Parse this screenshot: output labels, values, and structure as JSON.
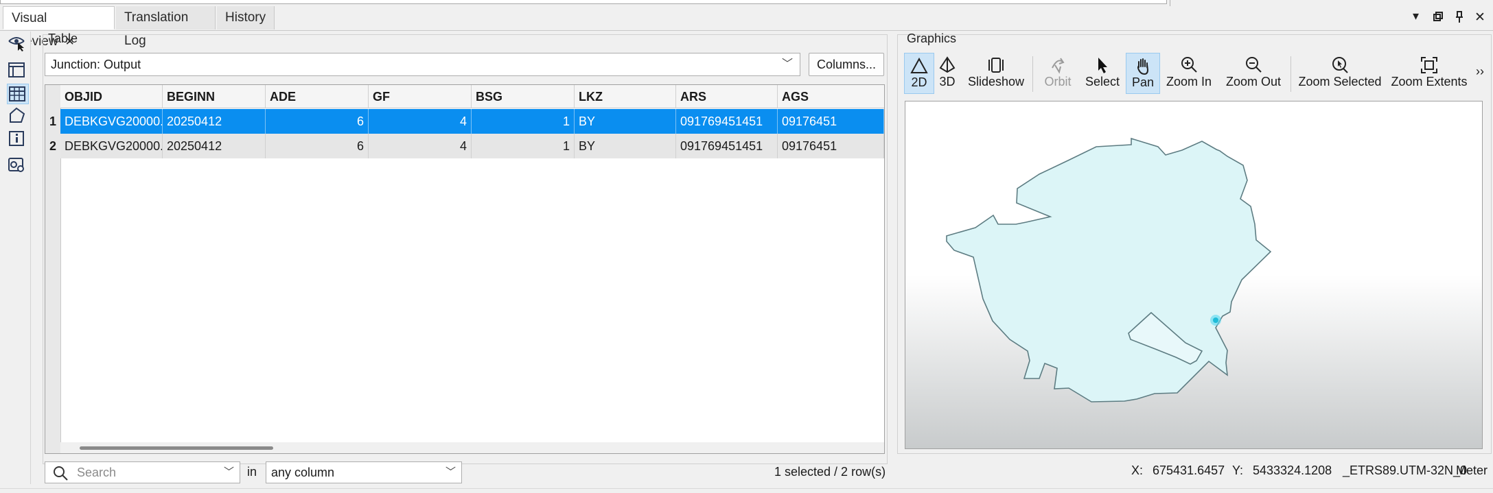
{
  "tabs": [
    {
      "label": "Visual Preview",
      "active": true
    },
    {
      "label": "Translation Log",
      "active": false
    },
    {
      "label": "History",
      "active": false
    }
  ],
  "left_toolbar": {
    "items": [
      "eye-select-icon",
      "layout-icon",
      "table-icon",
      "polygon-icon",
      "info-icon",
      "settings-card-icon"
    ],
    "selected": "table-icon"
  },
  "table": {
    "panel_title": "Table",
    "source_select": "Junction: Output",
    "columns_button": "Columns...",
    "headers": [
      "OBJID",
      "BEGINN",
      "ADE",
      "GF",
      "BSG",
      "LKZ",
      "ARS",
      "AGS"
    ],
    "rows": [
      {
        "num": "1",
        "cells": [
          "DEBKGVG20000...",
          "20250412",
          "6",
          "4",
          "1",
          "BY",
          "091769451451",
          "09176451"
        ],
        "selected": true
      },
      {
        "num": "2",
        "cells": [
          "DEBKGVG20000...",
          "20250412",
          "6",
          "4",
          "1",
          "BY",
          "091769451451",
          "09176451"
        ],
        "selected": false
      }
    ],
    "search_placeholder": "Search",
    "in_label": "in",
    "column_filter": "any column",
    "status": "1 selected / 2 row(s)"
  },
  "graphics": {
    "panel_title": "Graphics",
    "tools": [
      {
        "label": "2D",
        "icon": "triangle-2d-icon",
        "selected": true,
        "disabled": false
      },
      {
        "label": "3D",
        "icon": "pyramid-3d-icon",
        "selected": false,
        "disabled": false
      },
      {
        "label": "Slideshow",
        "icon": "slideshow-icon",
        "selected": false,
        "disabled": false
      },
      {
        "label": "Orbit",
        "icon": "orbit-icon",
        "selected": false,
        "disabled": true
      },
      {
        "label": "Select",
        "icon": "cursor-arrow-icon",
        "selected": false,
        "disabled": false
      },
      {
        "label": "Pan",
        "icon": "hand-icon",
        "selected": true,
        "disabled": false
      },
      {
        "label": "Zoom In",
        "icon": "zoom-in-icon",
        "selected": false,
        "disabled": false
      },
      {
        "label": "Zoom Out",
        "icon": "zoom-out-icon",
        "selected": false,
        "disabled": false
      },
      {
        "label": "Zoom Selected",
        "icon": "zoom-selected-icon",
        "selected": false,
        "disabled": false
      },
      {
        "label": "Zoom Extents",
        "icon": "zoom-extents-icon",
        "selected": false,
        "disabled": false
      }
    ],
    "overflow": "››",
    "coords": {
      "x_label": "X:",
      "x_value": "675431.6457",
      "y_label": "Y:",
      "y_value": "5433324.1208",
      "crs": "_ETRS89.UTM-32N_0",
      "unit": "Meter"
    }
  },
  "colors": {
    "selection": "#0a8ef0",
    "polygon_fill": "#dff6f8",
    "polygon_stroke": "#5a7f86",
    "highlight_point": "#20c8e0"
  }
}
